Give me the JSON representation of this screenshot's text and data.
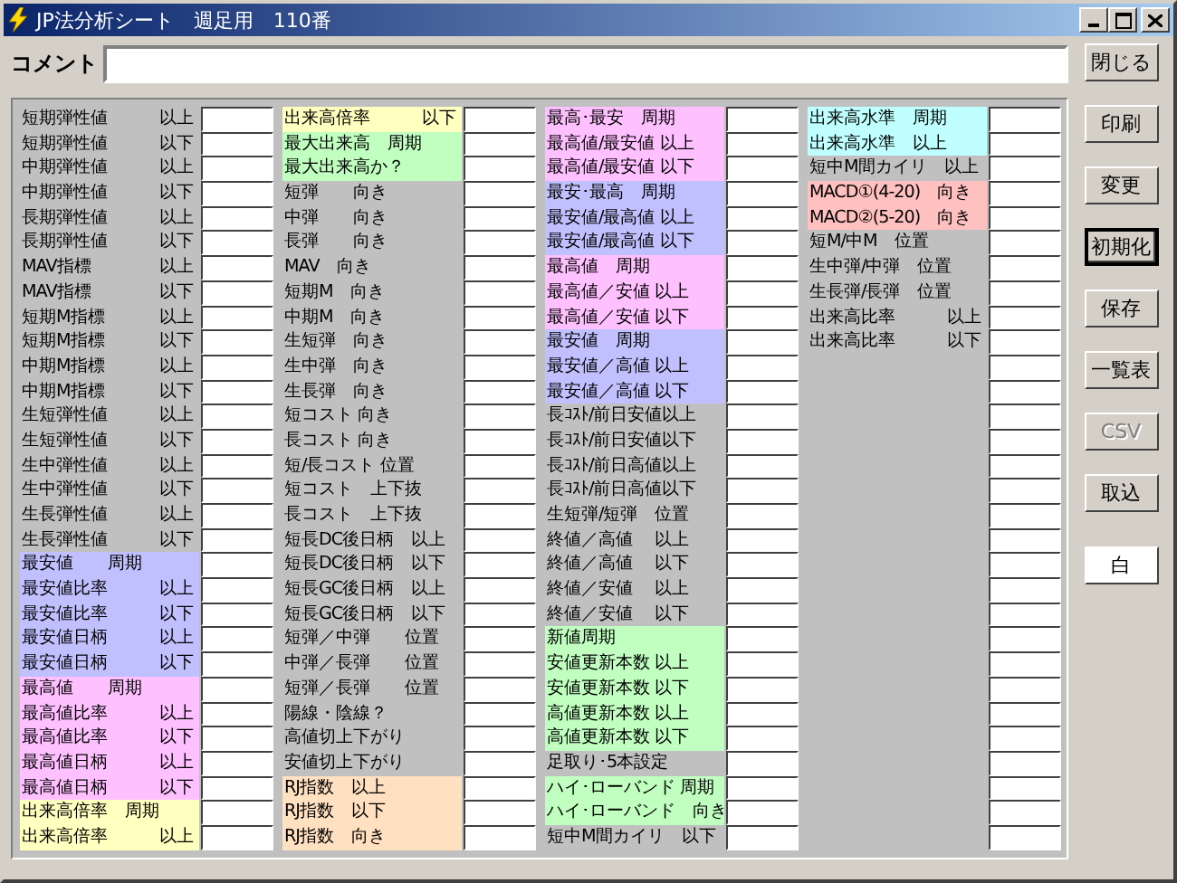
{
  "window": {
    "title": "JP法分析シート　週足用　110番"
  },
  "comment": {
    "label": "コメント"
  },
  "columns": [
    {
      "rows": [
        {
          "label": "短期弾性値",
          "qualifier": "以上"
        },
        {
          "label": "短期弾性値",
          "qualifier": "以下"
        },
        {
          "label": "中期弾性値",
          "qualifier": "以上"
        },
        {
          "label": "中期弾性値",
          "qualifier": "以下"
        },
        {
          "label": "長期弾性値",
          "qualifier": "以上"
        },
        {
          "label": "長期弾性値",
          "qualifier": "以下"
        },
        {
          "label": "MAV指標",
          "qualifier": "以上"
        },
        {
          "label": "MAV指標",
          "qualifier": "以下"
        },
        {
          "label": "短期M指標",
          "qualifier": "以上"
        },
        {
          "label": "短期M指標",
          "qualifier": "以下"
        },
        {
          "label": "中期M指標",
          "qualifier": "以上"
        },
        {
          "label": "中期M指標",
          "qualifier": "以下"
        },
        {
          "label": "生短弾性値",
          "qualifier": "以上"
        },
        {
          "label": "生短弾性値",
          "qualifier": "以下"
        },
        {
          "label": "生中弾性値",
          "qualifier": "以上"
        },
        {
          "label": "生中弾性値",
          "qualifier": "以下"
        },
        {
          "label": "生長弾性値",
          "qualifier": "以上"
        },
        {
          "label": "生長弾性値",
          "qualifier": "以下"
        },
        {
          "label": "最安値　　周期",
          "color": "#c0c0ff"
        },
        {
          "label": "最安値比率",
          "qualifier": "以上",
          "color": "#c0c0ff"
        },
        {
          "label": "最安値比率",
          "qualifier": "以下",
          "color": "#c0c0ff"
        },
        {
          "label": "最安値日柄",
          "qualifier": "以上",
          "color": "#c0c0ff"
        },
        {
          "label": "最安値日柄",
          "qualifier": "以下",
          "color": "#c0c0ff"
        },
        {
          "label": "最高値　　周期",
          "color": "#ffc0ff"
        },
        {
          "label": "最高値比率",
          "qualifier": "以上",
          "color": "#ffc0ff"
        },
        {
          "label": "最高値比率",
          "qualifier": "以下",
          "color": "#ffc0ff"
        },
        {
          "label": "最高値日柄",
          "qualifier": "以上",
          "color": "#ffc0ff"
        },
        {
          "label": "最高値日柄",
          "qualifier": "以下",
          "color": "#ffc0ff"
        },
        {
          "label": "出来高倍率　周期",
          "color": "#ffffc0"
        },
        {
          "label": "出来高倍率",
          "qualifier": "以上",
          "color": "#ffffc0"
        }
      ]
    },
    {
      "rows": [
        {
          "label": "出来高倍率",
          "qualifier": "以下",
          "color": "#ffffc0"
        },
        {
          "label": "最大出来高　周期",
          "color": "#c0ffc0"
        },
        {
          "label": "最大出来高か？",
          "color": "#c0ffc0"
        },
        {
          "label": "短弾　　向き"
        },
        {
          "label": "中弾　　向き"
        },
        {
          "label": "長弾　　向き"
        },
        {
          "label": "MAV　向き"
        },
        {
          "label": "短期M　向き"
        },
        {
          "label": "中期M　向き"
        },
        {
          "label": "生短弾　向き"
        },
        {
          "label": "生中弾　向き"
        },
        {
          "label": "生長弾　向き"
        },
        {
          "label": "短コスト 向き"
        },
        {
          "label": "長コスト 向き"
        },
        {
          "label": "短/長コスト 位置"
        },
        {
          "label": "短コスト　上下抜"
        },
        {
          "label": "長コスト　上下抜"
        },
        {
          "label": "短長DC後日柄　以上"
        },
        {
          "label": "短長DC後日柄　以下"
        },
        {
          "label": "短長GC後日柄　以上"
        },
        {
          "label": "短長GC後日柄　以下"
        },
        {
          "label": "短弾／中弾　　位置"
        },
        {
          "label": "中弾／長弾　　位置"
        },
        {
          "label": "短弾／長弾　　位置"
        },
        {
          "label": "陽線・陰線？"
        },
        {
          "label": "高値切上下がり"
        },
        {
          "label": "安値切上下がり"
        },
        {
          "label": "RJ指数　以上",
          "color": "#ffe0c0"
        },
        {
          "label": "RJ指数　以下",
          "color": "#ffe0c0"
        },
        {
          "label": "RJ指数　向き",
          "color": "#ffe0c0"
        }
      ]
    },
    {
      "rows": [
        {
          "label": "最高･最安　周期",
          "color": "#ffc0ff"
        },
        {
          "label": "最高値/最安値 以上",
          "color": "#ffc0ff"
        },
        {
          "label": "最高値/最安値 以下",
          "color": "#ffc0ff"
        },
        {
          "label": "最安･最高　周期",
          "color": "#c0c0ff"
        },
        {
          "label": "最安値/最高値 以上",
          "color": "#c0c0ff"
        },
        {
          "label": "最安値/最高値 以下",
          "color": "#c0c0ff"
        },
        {
          "label": "最高値　周期",
          "color": "#ffc0ff"
        },
        {
          "label": "最高値／安値 以上",
          "color": "#ffc0ff"
        },
        {
          "label": "最高値／安値 以下",
          "color": "#ffc0ff"
        },
        {
          "label": "最安値　周期",
          "color": "#c0c0ff"
        },
        {
          "label": "最安値／高値 以上",
          "color": "#c0c0ff"
        },
        {
          "label": "最安値／高値 以下",
          "color": "#c0c0ff"
        },
        {
          "label": "長ｺｽﾄ/前日安値以上"
        },
        {
          "label": "長ｺｽﾄ/前日安値以下"
        },
        {
          "label": "長ｺｽﾄ/前日高値以上"
        },
        {
          "label": "長ｺｽﾄ/前日高値以下"
        },
        {
          "label": "生短弾/短弾　位置"
        },
        {
          "label": "終値／高値　 以上"
        },
        {
          "label": "終値／高値　 以下"
        },
        {
          "label": "終値／安値　 以上"
        },
        {
          "label": "終値／安値　 以下"
        },
        {
          "label": "新値周期",
          "color": "#c0ffc0"
        },
        {
          "label": "安値更新本数 以上",
          "color": "#c0ffc0"
        },
        {
          "label": "安値更新本数 以下",
          "color": "#c0ffc0"
        },
        {
          "label": "高値更新本数 以上",
          "color": "#c0ffc0"
        },
        {
          "label": "高値更新本数 以下",
          "color": "#c0ffc0"
        },
        {
          "label": "足取り･5本設定"
        },
        {
          "label": "ハイ･ローバンド 周期",
          "color": "#c0ffc0"
        },
        {
          "label": "ハイ･ローバンド　向き",
          "color": "#c0ffc0"
        },
        {
          "label": "短中M間カイリ　以下"
        }
      ]
    },
    {
      "rows": [
        {
          "label": "出来高水準　周期",
          "color": "#c0ffff"
        },
        {
          "label": "出来高水準　以上",
          "color": "#c0ffff"
        },
        {
          "label": "短中M間カイリ　以上"
        },
        {
          "label": "MACD①(4-20)　向き",
          "color": "#ffc0c0"
        },
        {
          "label": "MACD②(5-20)　向き",
          "color": "#ffc0c0"
        },
        {
          "label": "短M/中M　位置"
        },
        {
          "label": "生中弾/中弾　位置"
        },
        {
          "label": "生長弾/長弾　位置"
        },
        {
          "label": "出来高比率",
          "qualifier": "以上"
        },
        {
          "label": "出来高比率",
          "qualifier": "以下"
        },
        {
          "kind": "blank"
        },
        {
          "kind": "blank"
        },
        {
          "kind": "blank"
        },
        {
          "kind": "blank"
        },
        {
          "kind": "blank"
        },
        {
          "kind": "blank"
        },
        {
          "kind": "blank"
        },
        {
          "kind": "blank"
        },
        {
          "kind": "blank"
        },
        {
          "kind": "blank"
        },
        {
          "kind": "blank"
        },
        {
          "kind": "blank"
        },
        {
          "kind": "blank"
        },
        {
          "kind": "blank"
        },
        {
          "kind": "blank"
        },
        {
          "kind": "blank"
        },
        {
          "kind": "blank"
        },
        {
          "kind": "blank"
        },
        {
          "kind": "blank"
        },
        {
          "kind": "blank"
        }
      ]
    }
  ],
  "buttons": [
    {
      "label": "閉じる",
      "kind": "button",
      "default": false,
      "disabled": false
    },
    {
      "label": "印刷",
      "kind": "button",
      "default": false,
      "disabled": false
    },
    {
      "label": "変更",
      "kind": "button",
      "default": false,
      "disabled": false
    },
    {
      "label": "初期化",
      "kind": "button",
      "default": true,
      "disabled": false
    },
    {
      "label": "保存",
      "kind": "button",
      "default": false,
      "disabled": false
    },
    {
      "label": "一覧表",
      "kind": "button",
      "default": false,
      "disabled": false
    },
    {
      "label": "CSV",
      "kind": "button",
      "default": false,
      "disabled": true
    },
    {
      "label": "取込",
      "kind": "button",
      "default": false,
      "disabled": false
    },
    {
      "label": "白",
      "kind": "swatch",
      "default": false,
      "disabled": false
    }
  ]
}
